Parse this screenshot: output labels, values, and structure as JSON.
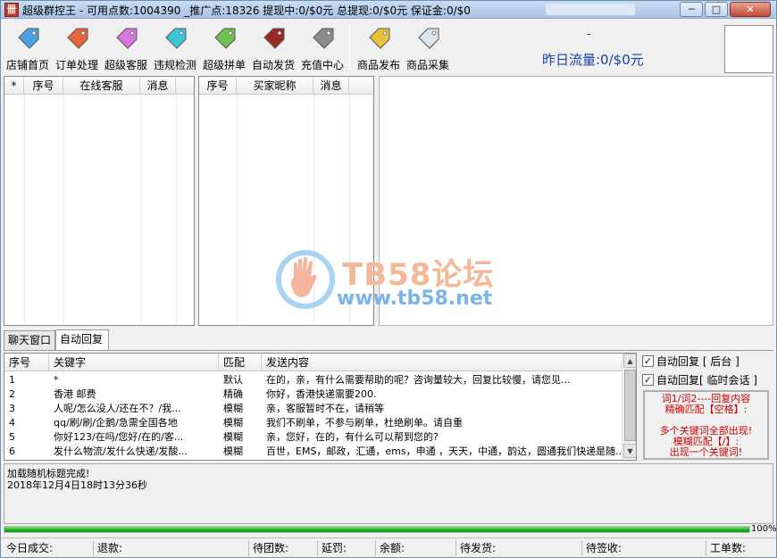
{
  "titlebar": {
    "icon_text": "卌",
    "title": "超级群控王 - 可用点数:1004390 _推广点:18326  提现中:0/$0元  总提现:0/$0元  保证金:0/$0"
  },
  "toolbar": {
    "items": [
      {
        "label": "店铺首页",
        "color": "#4aa3df"
      },
      {
        "label": "订单处理",
        "color": "#e8663c"
      },
      {
        "label": "超级客服",
        "color": "#d678e0"
      },
      {
        "label": "违规检测",
        "color": "#3cc6da"
      },
      {
        "label": "超级拼单",
        "color": "#6cc24a"
      },
      {
        "label": "自动发货",
        "color": "#9b2a22"
      },
      {
        "label": "充值中心",
        "color": "#8c8c8c"
      },
      {
        "label": "商品发布",
        "color": "#e7c33a"
      },
      {
        "label": "商品采集",
        "color": "#dde6ee"
      }
    ],
    "dash": "-",
    "traffic": "昨日流量:0/$0元"
  },
  "online_grid": {
    "headers": [
      "*",
      "序号",
      "在线客服",
      "消息"
    ]
  },
  "buyer_grid": {
    "headers": [
      "序号",
      "买家昵称",
      "消息"
    ]
  },
  "tabs": {
    "chat": "聊天窗口",
    "auto_reply": "自动回复"
  },
  "reply_table": {
    "headers": [
      "序号",
      "关键字",
      "匹配",
      "发送内容"
    ],
    "rows": [
      {
        "num": "1",
        "keyword": "*",
        "match": "默认",
        "content": "在的，亲，有什么需要帮助的呢？咨询量较大，回复比较慢，请您见..."
      },
      {
        "num": "2",
        "keyword": "香港 邮费",
        "match": "精确",
        "content": "你好，香港快递需要200."
      },
      {
        "num": "3",
        "keyword": "人呢/怎么没人/还在不？/我...",
        "match": "模糊",
        "content": "亲，客服暂时不在，请稍等"
      },
      {
        "num": "4",
        "keyword": "qq/刷/刷/企鹅/急需全国各地",
        "match": "模糊",
        "content": "我们不刷单，不参与刷单，杜绝刷单。请自重"
      },
      {
        "num": "5",
        "keyword": "你好123/在吗/您好/在的/客...",
        "match": "模糊",
        "content": "亲，您好，在的，有什么可以帮到您的?"
      },
      {
        "num": "6",
        "keyword": "发什么物流/发什么快递/发酸...",
        "match": "模糊",
        "content": "百世，EMS，邮政，汇通，ems，申通 ，天天，中通，韵达，圆通我们快递是随..."
      }
    ]
  },
  "right_panel": {
    "chk1_label": "自动回复 [ 后台 ]",
    "chk2_label": "自动回复[ 临时会话 ]",
    "hint_lines": [
      "词1/词2----回复内容",
      "精确匹配【空格】:",
      "",
      "多个关键词全部出现!",
      "模糊匹配【/】:",
      "出现一个关键词!"
    ]
  },
  "log": {
    "lines": [
      "加载随机标题完成!",
      "2018年12月4日18时13分36秒"
    ]
  },
  "progress": {
    "percent_label": "100%",
    "value": 1.0
  },
  "statusbar": {
    "today": "今日成交:",
    "refund": "退款:",
    "group": "待团数:",
    "penalty": "延罚:",
    "balance": "余额:",
    "to_ship": "待发货:",
    "to_receive": "待签收:",
    "tickets": "工单数:"
  },
  "watermark": {
    "title": "TB58论坛",
    "url": "www.tb58.net"
  },
  "colors": {
    "accent": "#1a3fa8",
    "hint_red": "#cc0000",
    "progress_green": "#19b319"
  }
}
